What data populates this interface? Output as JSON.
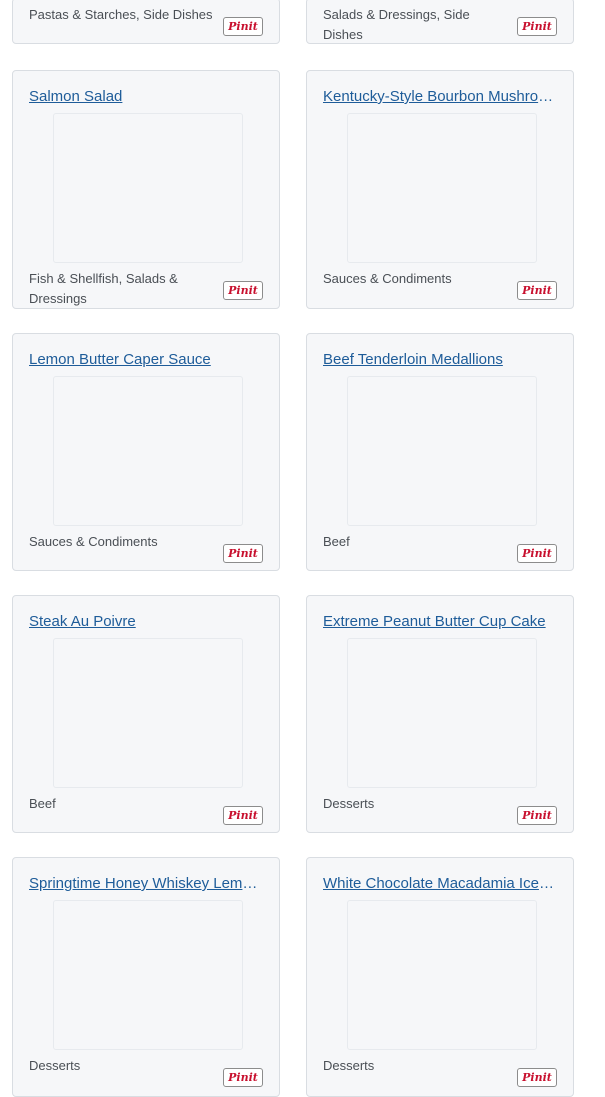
{
  "pin_label": "Pinit",
  "partial_cards": [
    {
      "categories": "Pastas & Starches, Side Dishes"
    },
    {
      "categories": "Salads & Dressings, Side Dishes"
    }
  ],
  "cards": [
    {
      "title": "Salmon Salad",
      "categories": "Fish & Shellfish, Salads & Dressings"
    },
    {
      "title": "Kentucky-Style Bourbon Mushrooms",
      "categories": "Sauces & Condiments"
    },
    {
      "title": "Lemon Butter Caper Sauce",
      "categories": "Sauces & Condiments"
    },
    {
      "title": "Beef Tenderloin Medallions",
      "categories": "Beef"
    },
    {
      "title": "Steak Au Poivre",
      "categories": "Beef"
    },
    {
      "title": "Extreme Peanut Butter Cup Cake",
      "categories": "Desserts"
    },
    {
      "title": "Springtime Honey Whiskey Lemonade",
      "categories": "Desserts"
    },
    {
      "title": "White Chocolate Macadamia Ice Cream",
      "categories": "Desserts"
    }
  ]
}
